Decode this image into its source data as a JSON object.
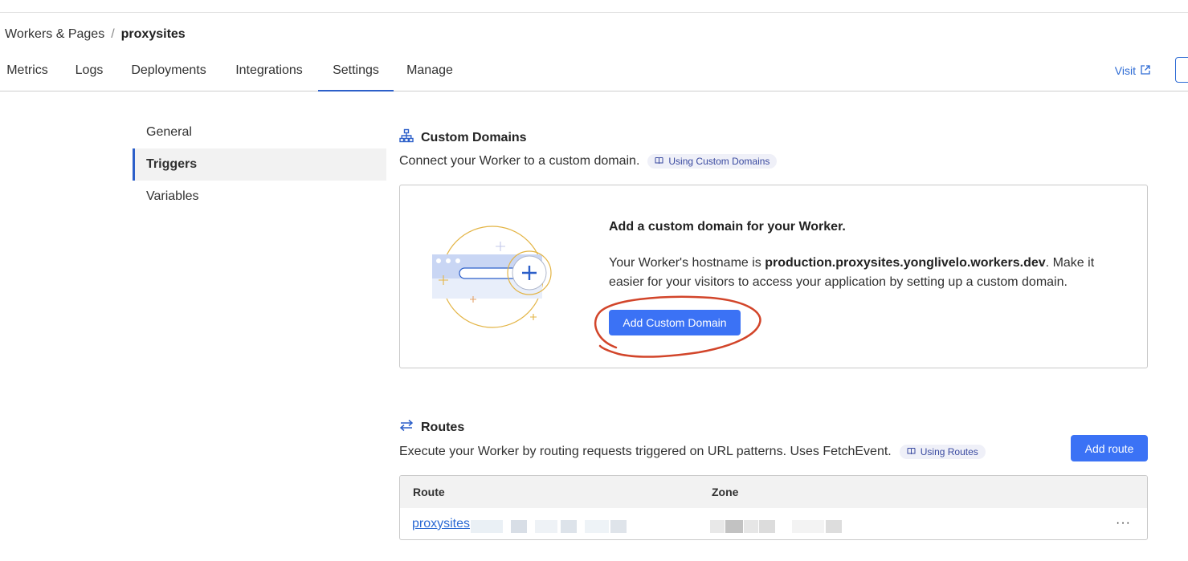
{
  "breadcrumb": {
    "parent": "Workers & Pages",
    "separator": "/",
    "current": "proxysites"
  },
  "tabs": [
    {
      "label": "Metrics"
    },
    {
      "label": "Logs"
    },
    {
      "label": "Deployments"
    },
    {
      "label": "Integrations"
    },
    {
      "label": "Settings",
      "active": true
    },
    {
      "label": "Manage"
    }
  ],
  "header_actions": {
    "visit_label": "Visit"
  },
  "sidebar": {
    "items": [
      {
        "label": "General"
      },
      {
        "label": "Triggers",
        "active": true
      },
      {
        "label": "Variables"
      }
    ]
  },
  "custom_domains": {
    "title": "Custom Domains",
    "description": "Connect your Worker to a custom domain.",
    "doc_link": "Using Custom Domains",
    "card_title": "Add a custom domain for your Worker.",
    "text_prefix": "Your Worker's hostname is ",
    "hostname": "production.proxysites.yonglivelo.workers.dev",
    "text_suffix": ". Make it easier for your visitors to access your application by setting up a custom domain.",
    "button": "Add Custom Domain"
  },
  "routes": {
    "title": "Routes",
    "description": "Execute your Worker by routing requests triggered on URL patterns. Uses FetchEvent.",
    "doc_link": "Using Routes",
    "add_button": "Add route",
    "columns": {
      "route": "Route",
      "zone": "Zone"
    },
    "rows": [
      {
        "route": "proxysites",
        "menu": "···"
      }
    ]
  },
  "colors": {
    "accent": "#3b72f5",
    "link": "#2c6ad4",
    "annotation": "#d2452a"
  }
}
